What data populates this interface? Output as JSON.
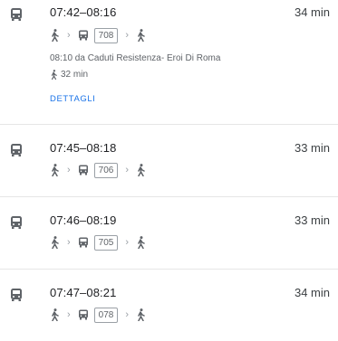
{
  "routes": [
    {
      "times": "07:42–08:16",
      "duration": "34 min",
      "line": "708",
      "departure_info": "08:10 da Caduti Resistenza- Eroi Di Roma",
      "walk_time": "32 min",
      "details_label": "DETTAGLI"
    },
    {
      "times": "07:45–08:18",
      "duration": "33 min",
      "line": "706"
    },
    {
      "times": "07:46–08:19",
      "duration": "33 min",
      "line": "705"
    },
    {
      "times": "07:47–08:21",
      "duration": "34 min",
      "line": "078"
    }
  ],
  "icons": {
    "mode": "bus-icon",
    "walk": "walk-icon",
    "separator": "chevron-right-icon",
    "transit": "bus-icon"
  },
  "colors": {
    "link": "#1a73e8",
    "primary_text": "#202124",
    "secondary_text": "#5f6368",
    "divider": "#e6e6e6"
  }
}
